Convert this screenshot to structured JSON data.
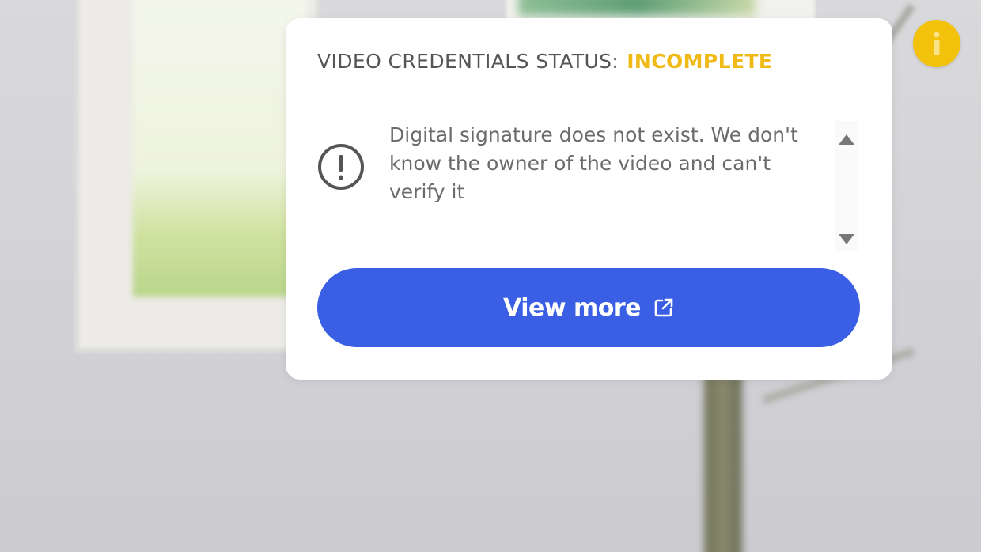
{
  "credentials": {
    "status_label": "VIDEO CREDENTIALS STATUS:",
    "status_value": "INCOMPLETE",
    "message": "Digital signature does not exist. We don't know the owner of the video and can't verify it",
    "view_more_label": "View more"
  },
  "icons": {
    "info": "info-icon",
    "alert": "exclamation-circle-icon",
    "external": "external-link-icon",
    "scroll_up": "scroll-up-arrow-icon",
    "scroll_down": "scroll-down-arrow-icon"
  },
  "colors": {
    "status_incomplete": "#efba16",
    "info_button": "#f3c20c",
    "primary_button": "#3a5fe5",
    "card_background": "#ffffff"
  }
}
